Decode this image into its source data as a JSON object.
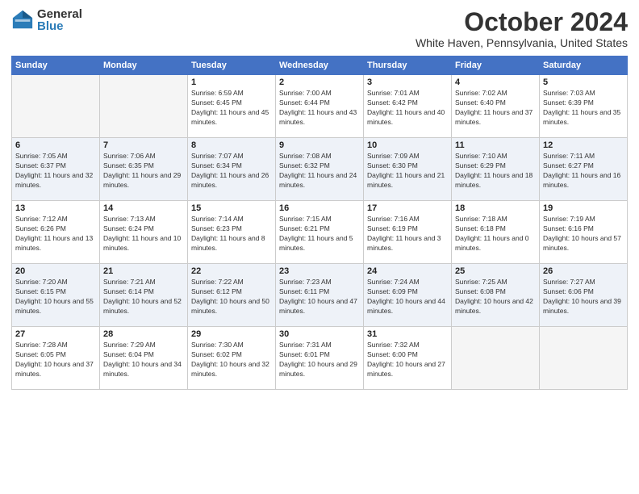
{
  "logo": {
    "general": "General",
    "blue": "Blue"
  },
  "header": {
    "month": "October 2024",
    "location": "White Haven, Pennsylvania, United States"
  },
  "weekdays": [
    "Sunday",
    "Monday",
    "Tuesday",
    "Wednesday",
    "Thursday",
    "Friday",
    "Saturday"
  ],
  "weeks": [
    [
      {
        "day": null
      },
      {
        "day": null
      },
      {
        "day": "1",
        "sunrise": "Sunrise: 6:59 AM",
        "sunset": "Sunset: 6:45 PM",
        "daylight": "Daylight: 11 hours and 45 minutes."
      },
      {
        "day": "2",
        "sunrise": "Sunrise: 7:00 AM",
        "sunset": "Sunset: 6:44 PM",
        "daylight": "Daylight: 11 hours and 43 minutes."
      },
      {
        "day": "3",
        "sunrise": "Sunrise: 7:01 AM",
        "sunset": "Sunset: 6:42 PM",
        "daylight": "Daylight: 11 hours and 40 minutes."
      },
      {
        "day": "4",
        "sunrise": "Sunrise: 7:02 AM",
        "sunset": "Sunset: 6:40 PM",
        "daylight": "Daylight: 11 hours and 37 minutes."
      },
      {
        "day": "5",
        "sunrise": "Sunrise: 7:03 AM",
        "sunset": "Sunset: 6:39 PM",
        "daylight": "Daylight: 11 hours and 35 minutes."
      }
    ],
    [
      {
        "day": "6",
        "sunrise": "Sunrise: 7:05 AM",
        "sunset": "Sunset: 6:37 PM",
        "daylight": "Daylight: 11 hours and 32 minutes."
      },
      {
        "day": "7",
        "sunrise": "Sunrise: 7:06 AM",
        "sunset": "Sunset: 6:35 PM",
        "daylight": "Daylight: 11 hours and 29 minutes."
      },
      {
        "day": "8",
        "sunrise": "Sunrise: 7:07 AM",
        "sunset": "Sunset: 6:34 PM",
        "daylight": "Daylight: 11 hours and 26 minutes."
      },
      {
        "day": "9",
        "sunrise": "Sunrise: 7:08 AM",
        "sunset": "Sunset: 6:32 PM",
        "daylight": "Daylight: 11 hours and 24 minutes."
      },
      {
        "day": "10",
        "sunrise": "Sunrise: 7:09 AM",
        "sunset": "Sunset: 6:30 PM",
        "daylight": "Daylight: 11 hours and 21 minutes."
      },
      {
        "day": "11",
        "sunrise": "Sunrise: 7:10 AM",
        "sunset": "Sunset: 6:29 PM",
        "daylight": "Daylight: 11 hours and 18 minutes."
      },
      {
        "day": "12",
        "sunrise": "Sunrise: 7:11 AM",
        "sunset": "Sunset: 6:27 PM",
        "daylight": "Daylight: 11 hours and 16 minutes."
      }
    ],
    [
      {
        "day": "13",
        "sunrise": "Sunrise: 7:12 AM",
        "sunset": "Sunset: 6:26 PM",
        "daylight": "Daylight: 11 hours and 13 minutes."
      },
      {
        "day": "14",
        "sunrise": "Sunrise: 7:13 AM",
        "sunset": "Sunset: 6:24 PM",
        "daylight": "Daylight: 11 hours and 10 minutes."
      },
      {
        "day": "15",
        "sunrise": "Sunrise: 7:14 AM",
        "sunset": "Sunset: 6:23 PM",
        "daylight": "Daylight: 11 hours and 8 minutes."
      },
      {
        "day": "16",
        "sunrise": "Sunrise: 7:15 AM",
        "sunset": "Sunset: 6:21 PM",
        "daylight": "Daylight: 11 hours and 5 minutes."
      },
      {
        "day": "17",
        "sunrise": "Sunrise: 7:16 AM",
        "sunset": "Sunset: 6:19 PM",
        "daylight": "Daylight: 11 hours and 3 minutes."
      },
      {
        "day": "18",
        "sunrise": "Sunrise: 7:18 AM",
        "sunset": "Sunset: 6:18 PM",
        "daylight": "Daylight: 11 hours and 0 minutes."
      },
      {
        "day": "19",
        "sunrise": "Sunrise: 7:19 AM",
        "sunset": "Sunset: 6:16 PM",
        "daylight": "Daylight: 10 hours and 57 minutes."
      }
    ],
    [
      {
        "day": "20",
        "sunrise": "Sunrise: 7:20 AM",
        "sunset": "Sunset: 6:15 PM",
        "daylight": "Daylight: 10 hours and 55 minutes."
      },
      {
        "day": "21",
        "sunrise": "Sunrise: 7:21 AM",
        "sunset": "Sunset: 6:14 PM",
        "daylight": "Daylight: 10 hours and 52 minutes."
      },
      {
        "day": "22",
        "sunrise": "Sunrise: 7:22 AM",
        "sunset": "Sunset: 6:12 PM",
        "daylight": "Daylight: 10 hours and 50 minutes."
      },
      {
        "day": "23",
        "sunrise": "Sunrise: 7:23 AM",
        "sunset": "Sunset: 6:11 PM",
        "daylight": "Daylight: 10 hours and 47 minutes."
      },
      {
        "day": "24",
        "sunrise": "Sunrise: 7:24 AM",
        "sunset": "Sunset: 6:09 PM",
        "daylight": "Daylight: 10 hours and 44 minutes."
      },
      {
        "day": "25",
        "sunrise": "Sunrise: 7:25 AM",
        "sunset": "Sunset: 6:08 PM",
        "daylight": "Daylight: 10 hours and 42 minutes."
      },
      {
        "day": "26",
        "sunrise": "Sunrise: 7:27 AM",
        "sunset": "Sunset: 6:06 PM",
        "daylight": "Daylight: 10 hours and 39 minutes."
      }
    ],
    [
      {
        "day": "27",
        "sunrise": "Sunrise: 7:28 AM",
        "sunset": "Sunset: 6:05 PM",
        "daylight": "Daylight: 10 hours and 37 minutes."
      },
      {
        "day": "28",
        "sunrise": "Sunrise: 7:29 AM",
        "sunset": "Sunset: 6:04 PM",
        "daylight": "Daylight: 10 hours and 34 minutes."
      },
      {
        "day": "29",
        "sunrise": "Sunrise: 7:30 AM",
        "sunset": "Sunset: 6:02 PM",
        "daylight": "Daylight: 10 hours and 32 minutes."
      },
      {
        "day": "30",
        "sunrise": "Sunrise: 7:31 AM",
        "sunset": "Sunset: 6:01 PM",
        "daylight": "Daylight: 10 hours and 29 minutes."
      },
      {
        "day": "31",
        "sunrise": "Sunrise: 7:32 AM",
        "sunset": "Sunset: 6:00 PM",
        "daylight": "Daylight: 10 hours and 27 minutes."
      },
      {
        "day": null
      },
      {
        "day": null
      }
    ]
  ]
}
